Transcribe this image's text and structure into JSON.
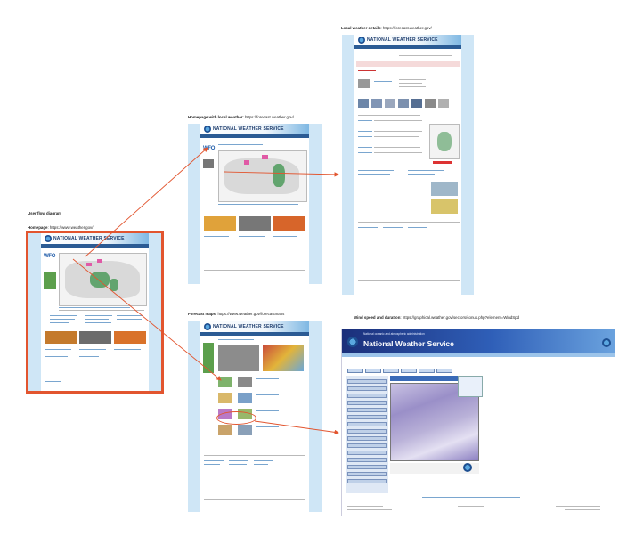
{
  "labels": {
    "user_flow": "User flow diagram",
    "homepage_title": "Homepage",
    "homepage_url": "https://www.weather.gov/",
    "local_weather_title": "Homepage with local weather",
    "local_weather_url": "https://forecast.weather.gov/",
    "local_details_title": "Local weather details",
    "local_details_url": "https://forecast.weather.gov/",
    "forecast_maps_title": "Forecast maps",
    "forecast_maps_url": "https://www.weather.gov/forecastmaps",
    "wind_title": "Wind speed and duration",
    "wind_url": "https://graphical.weather.gov/sectors/conus.php?element=WindSpd"
  },
  "screens": {
    "brand": "NATIONAL WEATHER SERVICE",
    "wfo": "WFO",
    "gfx_subtitle": "National oceanic and atmospheric administration",
    "gfx_title": "National Weather Service"
  },
  "colors": {
    "highlight": "#e2552f",
    "arrow": "#e2552f",
    "page_bg": "#cfe6f6"
  }
}
